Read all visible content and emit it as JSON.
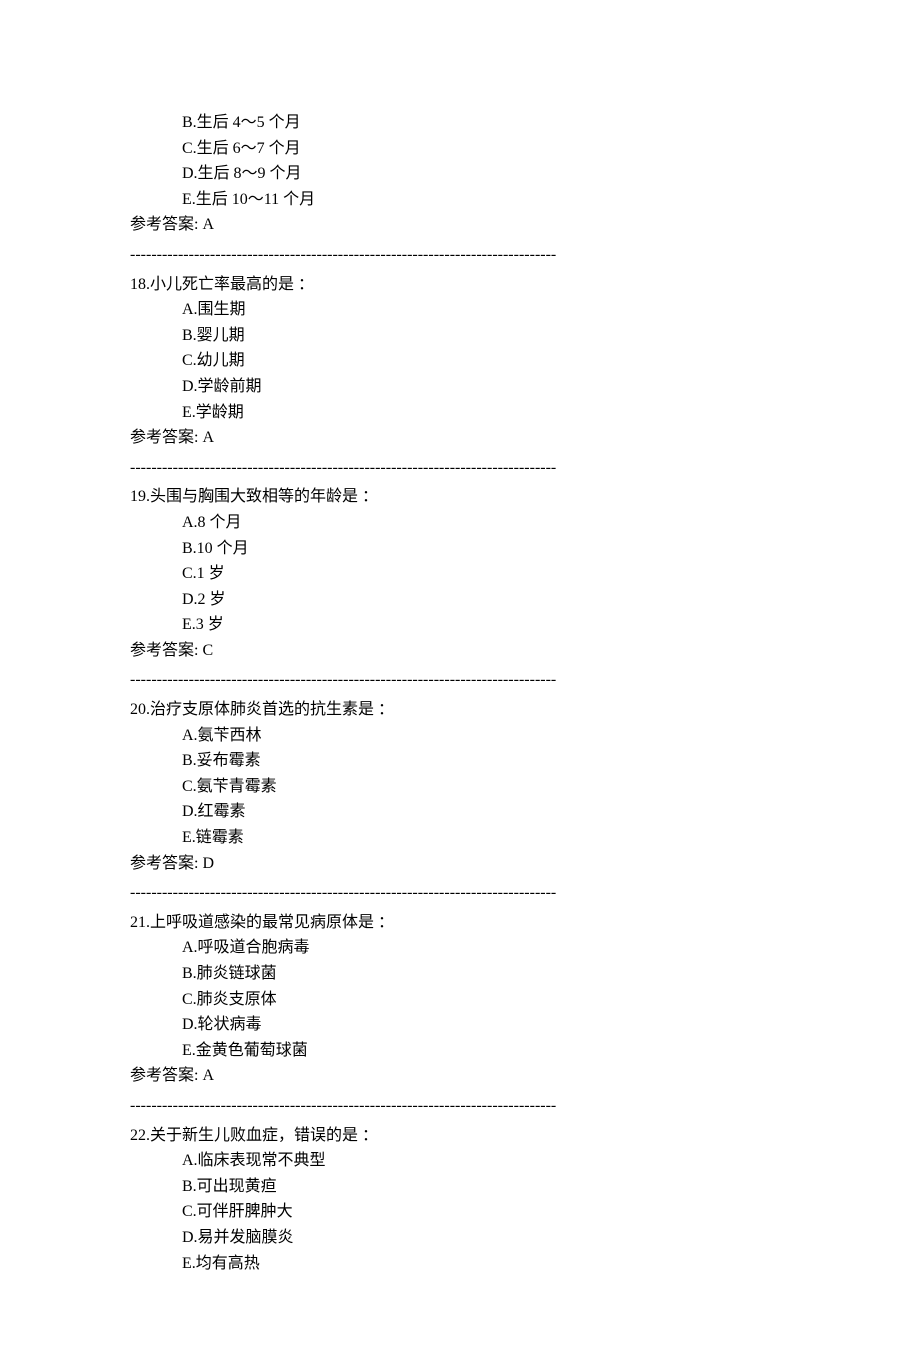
{
  "answer_label_prefix": "参考答案: ",
  "divider": "--------------------------------------------------------------------------------",
  "orphan_options": [
    "B.生后 4～5 个月",
    "C.生后 6～7 个月",
    "D.生后 8～9 个月",
    "E.生后 10～11 个月"
  ],
  "orphan_answer": "A",
  "questions": [
    {
      "number": "18",
      "text": "18.小儿死亡率最高的是 ：",
      "options": [
        "A.围生期",
        "B.婴儿期",
        "C.幼儿期",
        "D.学龄前期",
        "E.学龄期"
      ],
      "answer": "A"
    },
    {
      "number": "19",
      "text": "19.头围与胸围大致相等的年龄是 ：",
      "options": [
        "A.8 个月",
        "B.10 个月",
        "C.1 岁",
        "D.2 岁",
        "E.3 岁"
      ],
      "answer": "C"
    },
    {
      "number": "20",
      "text": "20.治疗支原体肺炎首选的抗生素是 ：",
      "options": [
        "A.氨苄西林",
        "B.妥布霉素",
        "C.氨苄青霉素",
        "D.红霉素",
        "E.链霉素"
      ],
      "answer": "D"
    },
    {
      "number": "21",
      "text": "21.上呼吸道感染的最常见病原体是 ：",
      "options": [
        "A.呼吸道合胞病毒",
        "B.肺炎链球菌",
        "C.肺炎支原体",
        "D.轮状病毒",
        "E.金黄色葡萄球菌"
      ],
      "answer": "A"
    },
    {
      "number": "22",
      "text": "22.关于新生儿败血症，错误的是 ：",
      "options": [
        "A.临床表现常不典型",
        "B.可出现黄疸",
        "C.可伴肝脾肿大",
        "D.易并发脑膜炎",
        "E.均有高热"
      ],
      "answer": null
    }
  ]
}
